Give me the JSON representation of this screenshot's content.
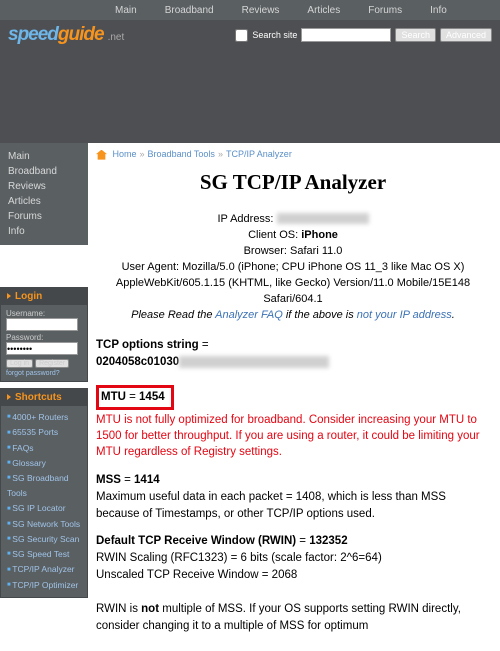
{
  "topnav": [
    "Main",
    "Broadband",
    "Reviews",
    "Articles",
    "Forums",
    "Info"
  ],
  "logo": {
    "p1": "speed",
    "p2": "guide",
    "suffix": ".net"
  },
  "search": {
    "label": "Search site",
    "placeholder": "",
    "btn1": "Search",
    "btn2": "Advanced"
  },
  "sidemenu": [
    "Main",
    "Broadband",
    "Reviews",
    "Articles",
    "Forums",
    "Info"
  ],
  "login": {
    "title": "Login",
    "u": "Username:",
    "p": "Password:",
    "pval": "••••••••",
    "b1": "Log in",
    "b2": "Register",
    "forgot": "forgot password?"
  },
  "shortcuts": {
    "title": "Shortcuts",
    "items": [
      "4000+ Routers",
      "65535 Ports",
      "FAQs",
      "Glossary",
      "SG Broadband Tools",
      "SG IP Locator",
      "SG Network Tools",
      "SG Security Scan",
      "SG Speed Test",
      "TCP/IP Analyzer",
      "TCP/IP Optimizer"
    ]
  },
  "breadcrumb": {
    "a": "Home",
    "b": "Broadband Tools",
    "c": "TCP/IP Analyzer"
  },
  "title": "SG TCP/IP Analyzer",
  "info": {
    "ip": "IP Address: ",
    "os": "Client OS: ",
    "osv": "iPhone",
    "br": "Browser: Safari 11.0",
    "ua": "User Agent: Mozilla/5.0 (iPhone; CPU iPhone OS 11_3 like Mac OS X) AppleWebKit/605.1.15 (KHTML, like Gecko) Version/11.0 Mobile/15E148 Safari/604.1",
    "note1": "Please Read the ",
    "faq": "Analyzer FAQ",
    "note2": " if the above is ",
    "nip": "not your IP address",
    "note3": "."
  },
  "tcp": {
    "label": "TCP options string",
    "eq": " = ",
    "val": "0204058c01030"
  },
  "mtu": {
    "label": "MTU",
    "eq": " = ",
    "val": "1454"
  },
  "warn": "MTU is not fully optimized for broadband. Consider increasing your MTU to 1500 for better throughput. If you are using a router, it could be limiting your MTU regardless of Registry settings.",
  "mss": {
    "label": "MSS",
    "eq": " = ",
    "val": "1414",
    "desc": "Maximum useful data in each packet = 1408, which is less than MSS because of Timestamps, or other TCP/IP options used."
  },
  "rwin": {
    "label": "Default TCP Receive Window (RWIN)",
    "eq": " = ",
    "val": "132352",
    "l1": "RWIN Scaling (RFC1323) = 6 bits (scale factor: 2^6=64)",
    "l2": "Unscaled TCP Receive Window = 2068",
    "l3a": "RWIN is ",
    "l3b": "not",
    "l3c": " multiple of MSS. If your OS supports setting RWIN directly, consider changing it to a multiple of MSS for optimum"
  }
}
